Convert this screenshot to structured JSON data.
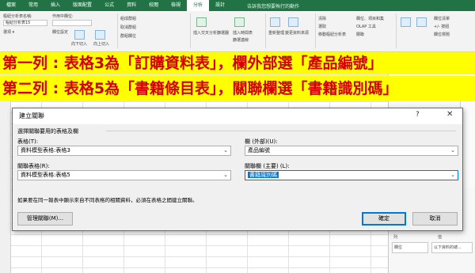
{
  "ribbon": {
    "tabs": [
      "檔案",
      "常用",
      "插入",
      "版面配置",
      "公式",
      "資料",
      "校閱",
      "檢視",
      "分析",
      "設計"
    ],
    "active_tab": "分析",
    "tell_me": "告訴我您想要執行的動作",
    "pivot_name_label": "樞紐分析表名稱:",
    "pivot_name_value": "樞紐分析表15",
    "options_label": "選項 ▾",
    "active_field_label": "作用中欄位:",
    "field_settings_label": "欄位設定",
    "drill_down": "向下切入",
    "drill_up": "向上切入",
    "group_selection": "組成群組",
    "ungroup": "取消群組",
    "group_field": "群組欄位",
    "insert_slicer": "插入交叉分析篩選器",
    "insert_timeline": "插入時間表",
    "filter_conn": "篩選連線",
    "refresh": "重新整理",
    "change_source": "變更資料來源",
    "clear": "清除",
    "select": "選取",
    "move_pivot": "移動樞紐分析表",
    "fields_items_sets": "欄位、項目和集",
    "olap_tools": "OLAP 工具",
    "relationships": "關聯",
    "pivot_chart": "樞紐分析圖",
    "recommended": "建議的樞紐分析表",
    "field_list": "欄位清單",
    "plus_minus": "+/- 按鈕",
    "field_headers": "欄位標題"
  },
  "banner1": "第一列 : 表格3為「訂購資料表」，欄外部選「產品編號」",
  "banner2": "第二列 : 表格5為「書籍條目表」，關聯欄選「書籍識別碼」",
  "dialog": {
    "title": "建立關聯",
    "help": "?",
    "close": "✕",
    "section": "選擇關聯要用的表格及欄",
    "table_label": "表格(T):",
    "table_value": "資料模型表格:表格3",
    "column_foreign_label": "欄 (外部)(U):",
    "column_foreign_value": "產品編號",
    "related_table_label": "關聯表格(R):",
    "related_table_value": "資料模型表格:表格5",
    "related_column_label": "關聯欄 (主要) (L):",
    "related_column_value": "書籍識別碼",
    "hint": "如果要在同一報表中顯示來自不同表格的相關資料，必須在表格之間建立關聯。",
    "manage_button": "管理關聯(M)...",
    "ok_button": "確定",
    "cancel_button": "取消"
  },
  "pane": {
    "columns_label": "欄",
    "rows_label": "列",
    "values_label": "值",
    "filter_value": "以下資料的總...",
    "row_value": "欄位"
  }
}
